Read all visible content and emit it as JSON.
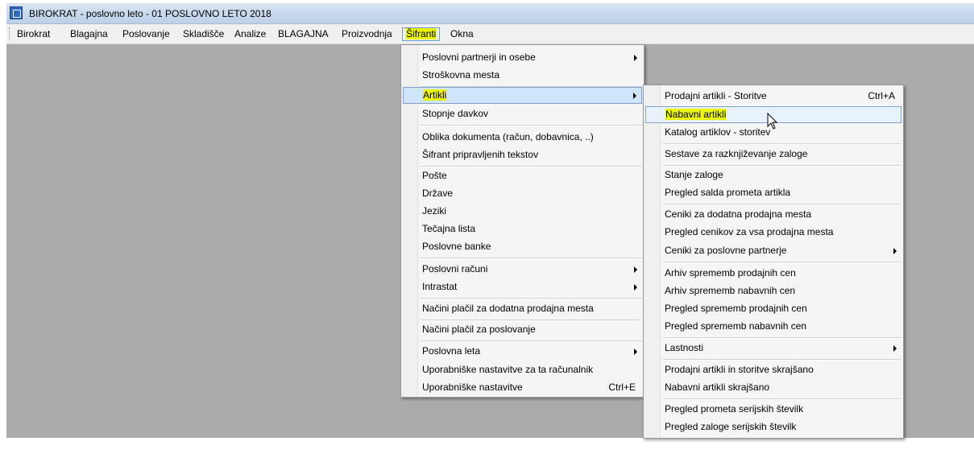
{
  "window": {
    "title": "BIROKRAT - poslovno leto - 01 POSLOVNO LETO 2018"
  },
  "menubar": {
    "items": [
      {
        "label": "Birokrat"
      },
      {
        "label": "Blagajna"
      },
      {
        "label": "Poslovanje"
      },
      {
        "label": "Skladišče"
      },
      {
        "label": "Analize"
      },
      {
        "label": "BLAGAJNA"
      },
      {
        "label": "Proizvodnja"
      },
      {
        "label": "Šifranti"
      },
      {
        "label": "Okna"
      }
    ]
  },
  "sifranti_menu": {
    "items": [
      {
        "label": "Poslovni partnerji in osebe",
        "submenu": true
      },
      {
        "label": "Stroškovna mesta"
      },
      {
        "label": "Artikli",
        "submenu": true,
        "selected": true
      },
      {
        "label": "Stopnje davkov"
      },
      {
        "label": "Oblika dokumenta (račun, dobavnica, ..)"
      },
      {
        "label": "Šifrant pripravljenih tekstov"
      },
      {
        "label": "Pošte"
      },
      {
        "label": "Države"
      },
      {
        "label": "Jeziki"
      },
      {
        "label": "Tečajna lista"
      },
      {
        "label": "Poslovne banke"
      },
      {
        "label": "Poslovni računi",
        "submenu": true
      },
      {
        "label": "Intrastat",
        "submenu": true
      },
      {
        "label": "Načini plačil za dodatna prodajna mesta"
      },
      {
        "label": "Načini plačil za poslovanje"
      },
      {
        "label": "Poslovna leta",
        "submenu": true
      },
      {
        "label": "Uporabniške nastavitve za ta računalnik"
      },
      {
        "label": "Uporabniške nastavitve",
        "shortcut": "Ctrl+E"
      }
    ]
  },
  "artikli_submenu": {
    "items": [
      {
        "label": "Prodajni artikli - Storitve",
        "shortcut": "Ctrl+A"
      },
      {
        "label": "Nabavni artikli",
        "hover": true
      },
      {
        "label": "Katalog artiklov - storitev"
      },
      {
        "label": "Sestave za razknjiževanje zaloge"
      },
      {
        "label": "Stanje zaloge"
      },
      {
        "label": "Pregled salda prometa artikla"
      },
      {
        "label": "Ceniki za dodatna prodajna mesta"
      },
      {
        "label": "Pregled cenikov za vsa prodajna mesta"
      },
      {
        "label": "Ceniki za poslovne partnerje",
        "submenu": true
      },
      {
        "label": "Arhiv sprememb prodajnih cen"
      },
      {
        "label": "Arhiv sprememb nabavnih cen"
      },
      {
        "label": "Pregled sprememb prodajnih cen"
      },
      {
        "label": "Pregled sprememb nabavnih cen"
      },
      {
        "label": "Lastnosti",
        "submenu": true
      },
      {
        "label": "Prodajni artikli in storitve skrajšano"
      },
      {
        "label": "Nabavni artikli skrajšano"
      },
      {
        "label": "Pregled prometa serijskih številk"
      },
      {
        "label": "Pregled zaloge serijskih številk"
      }
    ]
  },
  "colors": {
    "workspace": "#ababab",
    "highlight_marker": "#ecf500",
    "selection": "#cfe5fb"
  }
}
